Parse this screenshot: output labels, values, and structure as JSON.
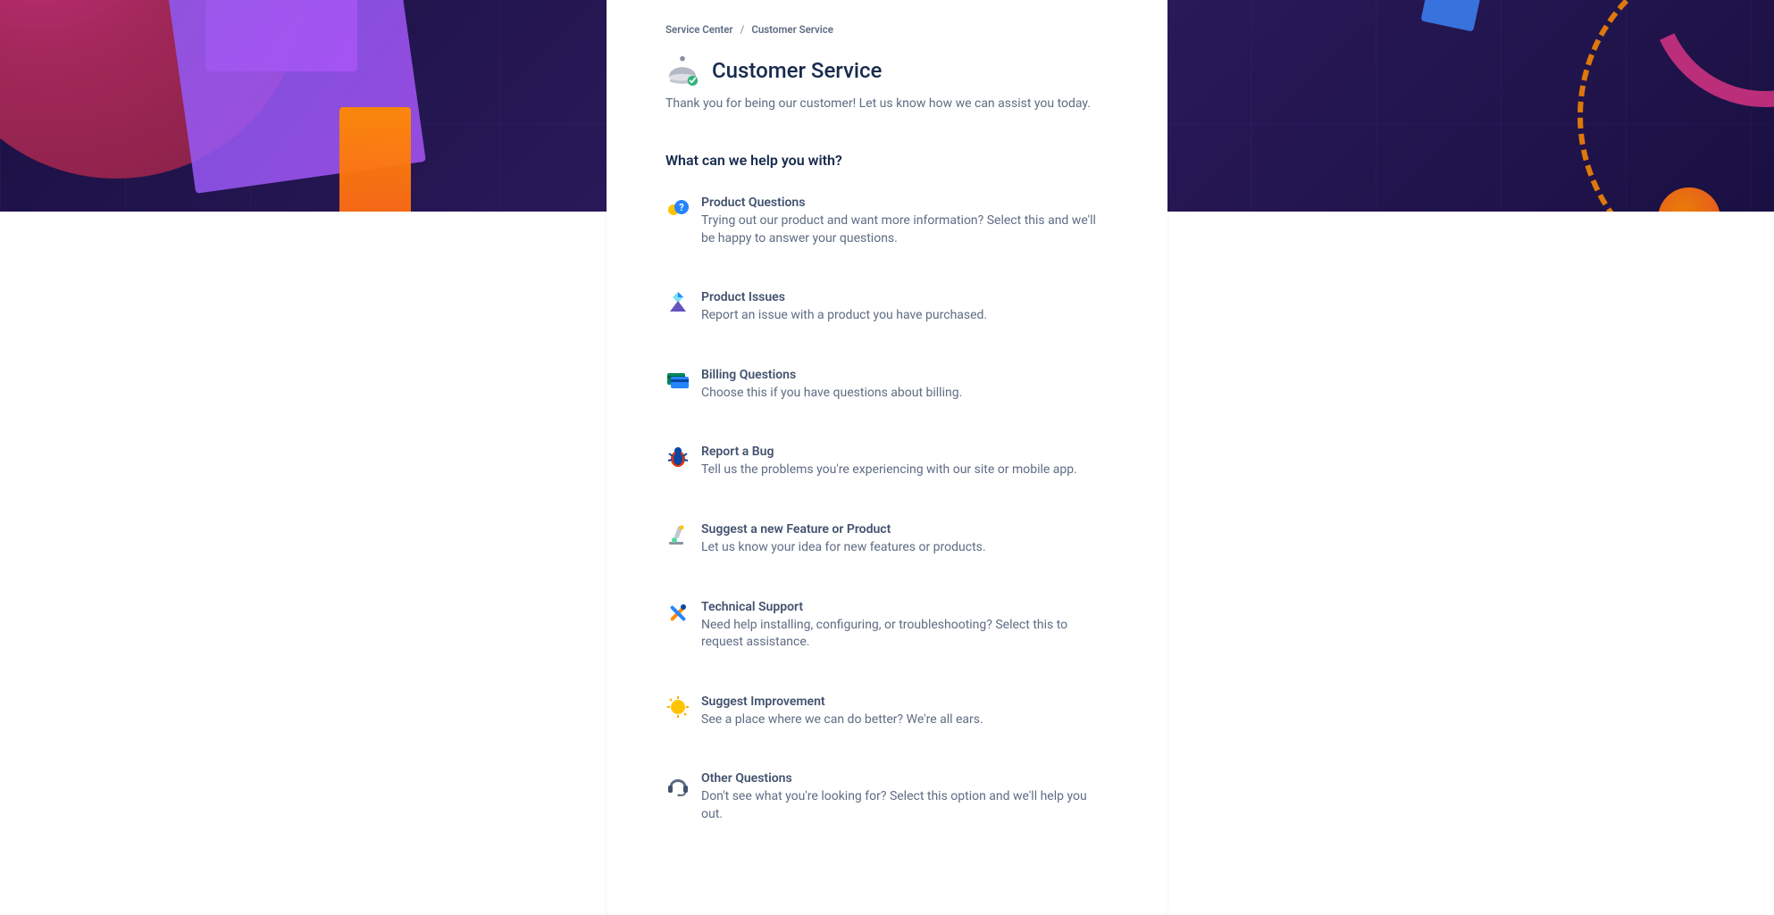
{
  "breadcrumb": {
    "root": "Service Center",
    "current": "Customer Service"
  },
  "title": "Customer Service",
  "subtitle": "Thank you for being our customer! Let us know how we can assist you today.",
  "section_heading": "What can we help you with?",
  "options": [
    {
      "title": "Product Questions",
      "desc": "Trying out our product and want more information? Select this and we'll be happy to answer your questions."
    },
    {
      "title": "Product Issues",
      "desc": "Report an issue with a product you have purchased."
    },
    {
      "title": "Billing Questions",
      "desc": "Choose this if you have questions about billing."
    },
    {
      "title": "Report a Bug",
      "desc": "Tell us the problems you're experiencing with our site or mobile app."
    },
    {
      "title": "Suggest a new Feature or Product",
      "desc": "Let us know your idea for new features or products."
    },
    {
      "title": "Technical Support",
      "desc": "Need help installing, configuring, or troubleshooting? Select this to request assistance."
    },
    {
      "title": "Suggest Improvement",
      "desc": "See a place where we can do better? We're all ears."
    },
    {
      "title": "Other Questions",
      "desc": "Don't see what you're looking for? Select this option and we'll help you out."
    }
  ]
}
